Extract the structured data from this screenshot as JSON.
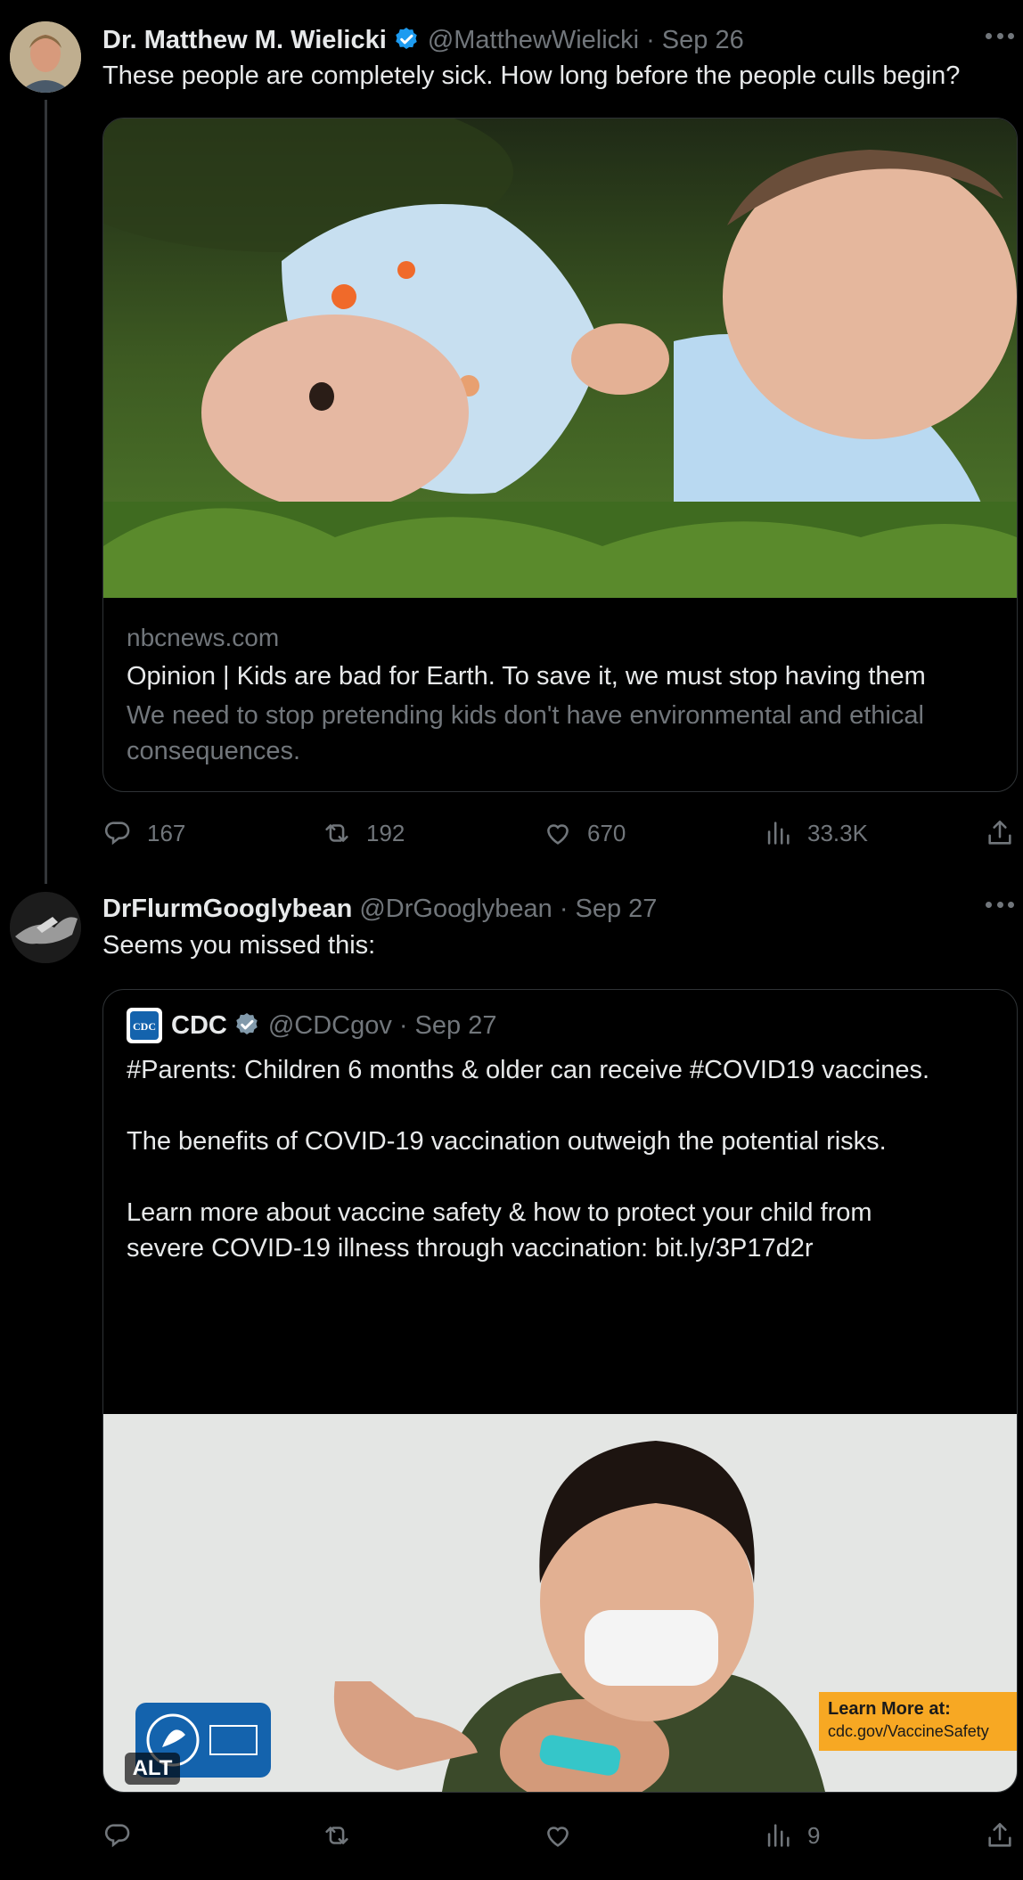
{
  "tweets": [
    {
      "author": {
        "name": "Dr. Matthew M. Wielicki",
        "handle": "@MatthewWielicki",
        "verified": true
      },
      "date": "Sep 26",
      "separator": "·",
      "text": "These people are completely sick. How long before the people culls begin?",
      "card": {
        "domain": "nbcnews.com",
        "title": "Opinion | Kids are bad for Earth. To save it, we must stop having them",
        "description": "We need to stop pretending kids don't have environmental and ethical consequences."
      },
      "stats": {
        "replies": "167",
        "reposts": "192",
        "likes": "670",
        "views": "33.3K"
      }
    },
    {
      "author": {
        "name": "DrFlurmGooglybean",
        "handle": "@DrGooglybean",
        "verified": false
      },
      "date": "Sep 27",
      "separator": "·",
      "text": "Seems you missed this:",
      "quote": {
        "author": {
          "name": "CDC",
          "handle": "@CDCgov",
          "verified": true
        },
        "date": "Sep 27",
        "separator": "·",
        "lines": [
          "#Parents: Children 6 months & older can receive #COVID19 vaccines.",
          "The benefits of COVID-19 vaccination outweigh the potential risks.",
          "Learn more about vaccine safety & how to protect your child from",
          "severe COVID-19 illness through vaccination: bit.ly/3P17d2r"
        ],
        "image": {
          "alt_badge": "ALT",
          "promo_line1": "Learn More at:",
          "promo_line2": "cdc.gov/VaccineSafety",
          "logo_text": "CDC"
        }
      },
      "stats": {
        "views": "9"
      }
    }
  ],
  "colors": {
    "background": "#000000",
    "text": "#e7e9ea",
    "muted": "#71767b",
    "border": "#2f3336",
    "verified": "#1d9bf0",
    "gov_verified": "#829aab",
    "promo": "#f7a823"
  },
  "icons": [
    "more-icon",
    "verified-badge-icon",
    "reply-icon",
    "repost-icon",
    "like-icon",
    "views-icon",
    "share-icon"
  ]
}
